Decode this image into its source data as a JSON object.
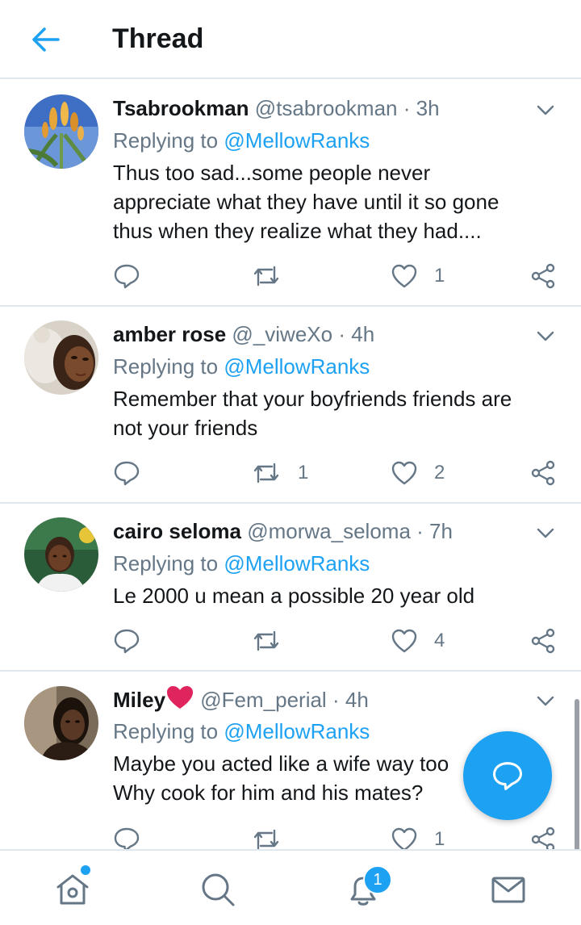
{
  "header": {
    "title": "Thread"
  },
  "colors": {
    "accent": "#1da1f2",
    "secondary_text": "#657786",
    "divider": "#e1e8ed",
    "heart_emoji": "#e0245e"
  },
  "tweets": [
    {
      "name": "Tsabrookman",
      "handle": "@tsabrookman",
      "separator": "·",
      "time": "3h",
      "replying_prefix": "Replying to ",
      "replying_to": "@MellowRanks",
      "text": "Thus too sad...some people never\nappreciate what they have until it so gone\nthus when they realize what they had....",
      "reply_count": "",
      "retweet_count": "",
      "like_count": "1",
      "avatar_icon": "aloe-flower-avatar"
    },
    {
      "name": "amber rose",
      "handle": "@_viweXo",
      "separator": "·",
      "time": "4h",
      "replying_prefix": "Replying to ",
      "replying_to": "@MellowRanks",
      "text": "Remember that your boyfriends friends are\nnot your friends",
      "reply_count": "",
      "retweet_count": "1",
      "like_count": "2",
      "avatar_icon": "person-with-teddy-avatar"
    },
    {
      "name": "cairo seloma",
      "handle": "@morwa_seloma",
      "separator": "·",
      "time": "7h",
      "replying_prefix": "Replying to ",
      "replying_to": "@MellowRanks",
      "text": "Le 2000 u mean a possible 20 year old",
      "reply_count": "",
      "retweet_count": "",
      "like_count": "4",
      "avatar_icon": "child-portrait-avatar"
    },
    {
      "name": "Miley",
      "handle": "@Fem_perial",
      "separator": "·",
      "time": "4h",
      "replying_prefix": "Replying to ",
      "replying_to": "@MellowRanks",
      "text": "Maybe you acted like a wife way too\nWhy cook for him and his mates?",
      "reply_count": "",
      "retweet_count": "",
      "like_count": "1",
      "avatar_icon": "woman-portrait-avatar",
      "name_emoji": "red-heart-emoji"
    }
  ],
  "bottom_nav": {
    "items": [
      "home-icon",
      "search-icon",
      "notifications-icon",
      "messages-icon"
    ],
    "notification_badge": "1"
  },
  "fab": {
    "icon": "compose-reply-icon"
  }
}
